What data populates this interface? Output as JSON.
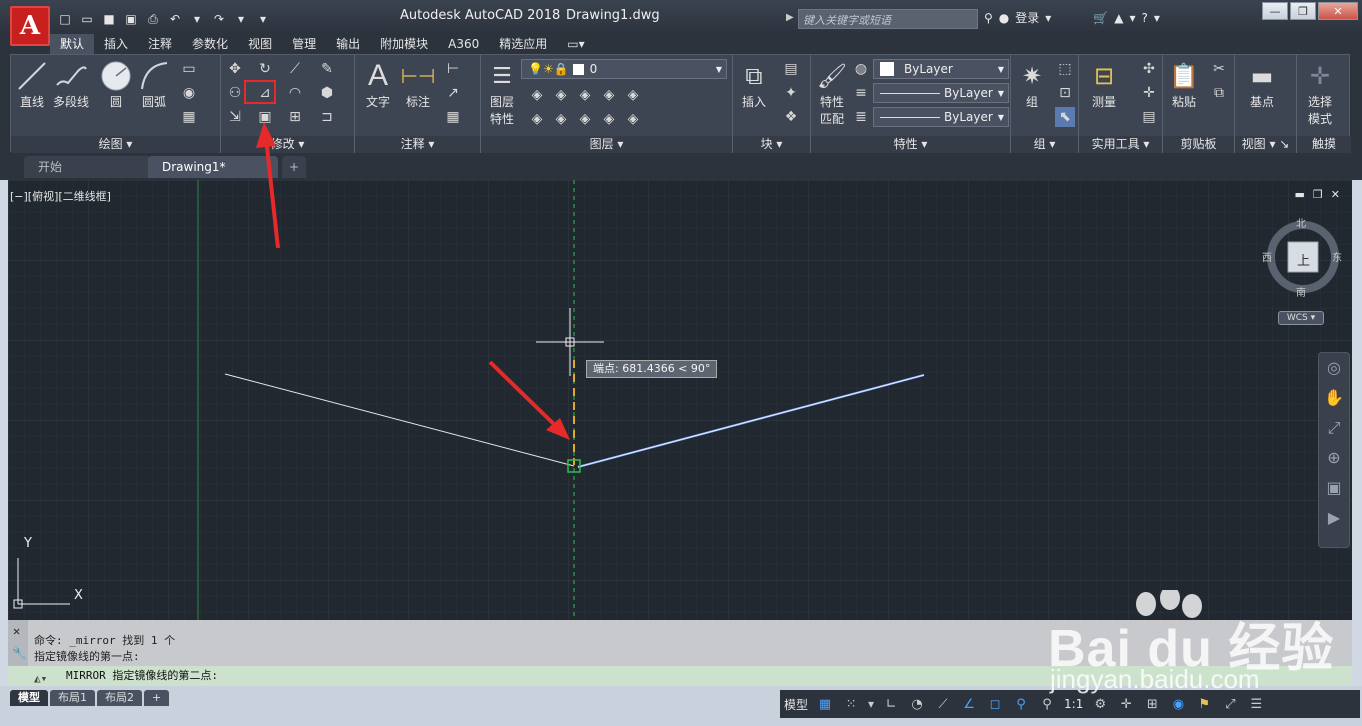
{
  "window": {
    "app_title": "Autodesk AutoCAD 2018",
    "file_name": "Drawing1.dwg",
    "search_placeholder": "键入关键字或短语",
    "login_label": "登录"
  },
  "ribbon_tabs": [
    "默认",
    "插入",
    "注释",
    "参数化",
    "视图",
    "管理",
    "输出",
    "附加模块",
    "A360",
    "精选应用"
  ],
  "panels": {
    "draw": {
      "label": "绘图",
      "tools": [
        "直线",
        "多段线",
        "圆",
        "圆弧"
      ]
    },
    "modify": {
      "label": "修改"
    },
    "annotation": {
      "label": "注释",
      "tools": [
        "文字",
        "标注"
      ]
    },
    "layers": {
      "label": "图层",
      "tool": "图层\n特性",
      "tool_line1": "图层",
      "tool_line2": "特性",
      "current_layer": "0"
    },
    "block": {
      "label": "块",
      "tool": "插入"
    },
    "properties": {
      "label": "特性",
      "tool_line1": "特性",
      "tool_line2": "匹配",
      "color": "ByLayer",
      "linetype": "ByLayer",
      "lineweight": "ByLayer"
    },
    "groups": {
      "label": "组",
      "tool": "组"
    },
    "utilities": {
      "label": "实用工具",
      "tool": "测量"
    },
    "clipboard": {
      "label": "剪贴板",
      "tool": "粘贴"
    },
    "view": {
      "label": "视图",
      "tool": "基点"
    },
    "touch": {
      "label": "触摸",
      "tool_line1": "选择",
      "tool_line2": "模式"
    }
  },
  "doc_tabs": [
    "开始",
    "Drawing1*"
  ],
  "viewport": {
    "label": "[−][俯视][二维线框]",
    "viewcube": {
      "north": "北",
      "south": "南",
      "east": "东",
      "west": "西",
      "face": "上",
      "wcs": "WCS"
    },
    "tooltip": "端点: 681.4366 < 90°",
    "ucs_x": "X",
    "ucs_y": "Y"
  },
  "command": {
    "history_1": "命令: _mirror 找到 1 个",
    "history_2": "指定镜像线的第一点:",
    "current": "MIRROR 指定镜像线的第二点:"
  },
  "layout_tabs": [
    "模型",
    "布局1",
    "布局2"
  ],
  "status": {
    "model_label": "模型",
    "scale": "1:1"
  },
  "watermark": {
    "brand": "Bai du 经验",
    "url": "jingyan.baidu.com"
  },
  "colors": {
    "canvas_bg": "#212830",
    "accent_red": "#e62a2a",
    "selected_line": "#8fb5ff",
    "green_axis": "#2fbf4a"
  }
}
